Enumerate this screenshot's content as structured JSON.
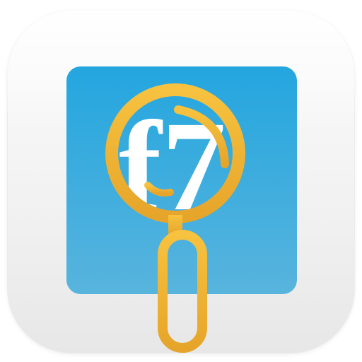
{
  "app_icon": {
    "name": "magnifier-icon",
    "logo_text": "f7",
    "colors": {
      "tile_background": "#f3f3f3",
      "blue_square": "#2aa9df",
      "blue_square_bottom": "#56b3dc",
      "magnifier_gold": "#f3b93a",
      "magnifier_gold_dark": "#e9a829",
      "logo_white": "#ffffff"
    }
  }
}
